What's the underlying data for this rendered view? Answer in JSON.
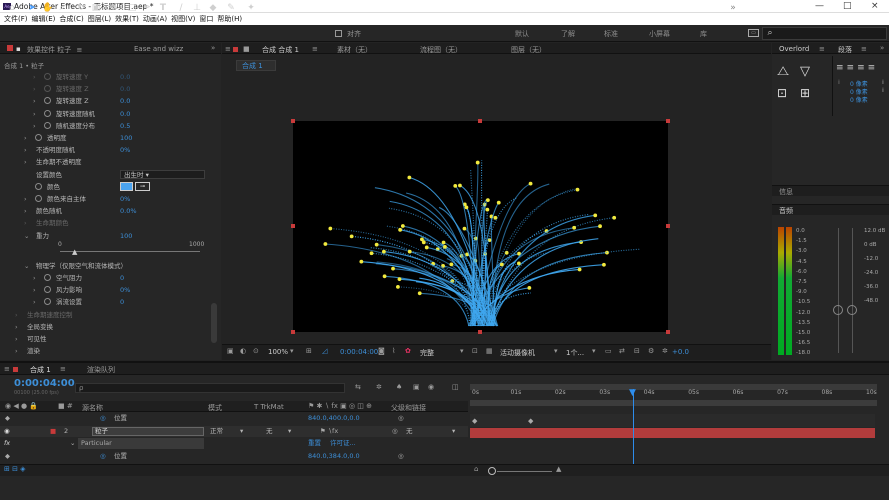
{
  "window": {
    "title": "Adobe After Effects - 无标题项目.aep *",
    "logo": "Ae",
    "controls": [
      "—",
      "□",
      "×"
    ]
  },
  "menu": [
    "文件(F)",
    "编辑(E)",
    "合成(C)",
    "图层(L)",
    "效果(T)",
    "动画(A)",
    "视图(V)",
    "窗口",
    "帮助(H)"
  ],
  "toolbar": {
    "snap_label": "对齐",
    "workspaces": [
      "默认",
      "了解",
      "标准",
      "小屏幕",
      "库"
    ],
    "search_icon": "search-icon"
  },
  "effects_panel": {
    "tab_label": "效果控件 粒子",
    "tab_menu": "≡",
    "tab2_label": "Ease and wizz",
    "breadcrumb": "合成 1 • 粒子",
    "rows": [
      {
        "label": "旋转速度 Y",
        "value": "0.0",
        "indent": 3,
        "stopwatch": true,
        "chev": true,
        "dim": true
      },
      {
        "label": "旋转速度 Z",
        "value": "0.0",
        "indent": 3,
        "stopwatch": true,
        "chev": true,
        "dim": true
      },
      {
        "label": "旋转速度 Z",
        "value": "0.0",
        "indent": 3,
        "stopwatch": true,
        "chev": true
      },
      {
        "label": "旋转速度随机",
        "value": "0.0",
        "indent": 3,
        "stopwatch": true,
        "chev": true
      },
      {
        "label": "随机速度分布",
        "value": "0.5",
        "indent": 3,
        "stopwatch": true,
        "chev": true
      },
      {
        "label": "透明度",
        "value": "100",
        "indent": 2,
        "stopwatch": true,
        "chev": true
      },
      {
        "label": "不透明度随机",
        "value": "0%",
        "indent": 2,
        "stopwatch": false,
        "chev": true
      },
      {
        "label": "生命期不透明度",
        "value": "",
        "indent": 2,
        "stopwatch": false,
        "chev": true
      },
      {
        "label": "设置颜色",
        "value": "",
        "indent": 2,
        "stopwatch": false,
        "chev": false
      },
      {
        "label": "颜色",
        "value": "",
        "indent": 2,
        "stopwatch": true,
        "chev": false
      },
      {
        "label": "颜色来自主体",
        "value": "0%",
        "indent": 2,
        "stopwatch": true,
        "chev": true
      },
      {
        "label": "颜色随机",
        "value": "0.0%",
        "indent": 2,
        "stopwatch": false,
        "chev": true
      },
      {
        "label": "生命期颜色",
        "value": "",
        "indent": 2,
        "stopwatch": false,
        "chev": true,
        "dim": true
      },
      {
        "label": "重力",
        "value": "100",
        "indent": 2,
        "stopwatch": false,
        "chev": true,
        "open": true
      }
    ],
    "set_color_value": "出生时",
    "color_swatch": "#4aa3ef",
    "slider": {
      "min": "0",
      "max": "1000",
      "value": 100
    },
    "rows2": [
      {
        "label": "物理学（仅限空气和流体模式）",
        "value": "",
        "indent": 2,
        "chev": true,
        "open": true
      },
      {
        "label": "空气阻力",
        "value": "0",
        "indent": 3,
        "stopwatch": true,
        "chev": true
      },
      {
        "label": "风力影响",
        "value": "0%",
        "indent": 3,
        "stopwatch": true,
        "chev": true
      },
      {
        "label": "涡流设置",
        "value": "0",
        "indent": 3,
        "stopwatch": true,
        "chev": true
      },
      {
        "label": "生命期速度控制",
        "value": "",
        "indent": 1,
        "chev": true,
        "dim": true
      },
      {
        "label": "全局变换",
        "value": "",
        "indent": 1,
        "chev": true
      },
      {
        "label": "可见性",
        "value": "",
        "indent": 1,
        "chev": true
      },
      {
        "label": "渲染",
        "value": "",
        "indent": 1,
        "chev": true
      }
    ]
  },
  "comp_panel": {
    "tabs": [
      {
        "label": "合成 合成 1",
        "active": true
      },
      {
        "label": "素材（无）"
      },
      {
        "label": "流程图（无）"
      },
      {
        "label": "图层（无）"
      }
    ],
    "comp_tab": "合成 1",
    "footer": {
      "zoom": "100%",
      "time": "0:00:04:00",
      "quality": "完整",
      "camera": "活动摄像机",
      "views": "1个...",
      "exposure": "+0.0"
    }
  },
  "right_panels": {
    "overlord_tab": "Overlord",
    "paragraph_tab": "段落",
    "indent_values": [
      "0 像素",
      "0 像素",
      "0 像素",
      "0 像素"
    ],
    "info_tab": "信息",
    "audio_tab": "音频",
    "audio_scale": [
      "0.0",
      "-1.5",
      "-3.0",
      "-4.5",
      "-6.0",
      "-7.5",
      "-9.0",
      "-10.5",
      "-12.0",
      "-13.5",
      "-15.0",
      "-16.5",
      "-18.0"
    ],
    "audio_scale_r": [
      "12.0 dB",
      "0 dB",
      "-12.0",
      "-24.0",
      "-36.0",
      "-48.0"
    ]
  },
  "timeline": {
    "tab_label": "合成 1",
    "tab2_label": "渲染队列",
    "timecode": "0:00:04:00",
    "fps": "00100 (25.00 fps)",
    "search_placeholder": "ρ",
    "headers": {
      "name": "源名称",
      "mode": "模式",
      "trk": "T TrkMat",
      "parent": "父级和链接"
    },
    "ruler": [
      "0s",
      "01s",
      "02s",
      "03s",
      "04s",
      "05s",
      "06s",
      "07s",
      "08s",
      "10s"
    ],
    "rows": [
      {
        "label": "位置",
        "value": "840.0,400.0,0.0",
        "type": "prop"
      },
      {
        "num": "2",
        "name": "粒子",
        "mode": "正常",
        "trk": "无",
        "parent": "无",
        "type": "layer"
      },
      {
        "label": "Particular",
        "fx_links": [
          "重置",
          "许可证..."
        ],
        "type": "fx"
      },
      {
        "label": "位置",
        "value": "840.0,384.0,0.0",
        "type": "prop"
      }
    ],
    "playhead_percent": 40
  },
  "colors": {
    "accent": "#3d8fd8",
    "highlight_blue": "#2d8ceb",
    "red": "#c83a3a",
    "bar": "#b23c3c",
    "particle": "#3fa7ef",
    "dot": "#f2ea3e"
  }
}
